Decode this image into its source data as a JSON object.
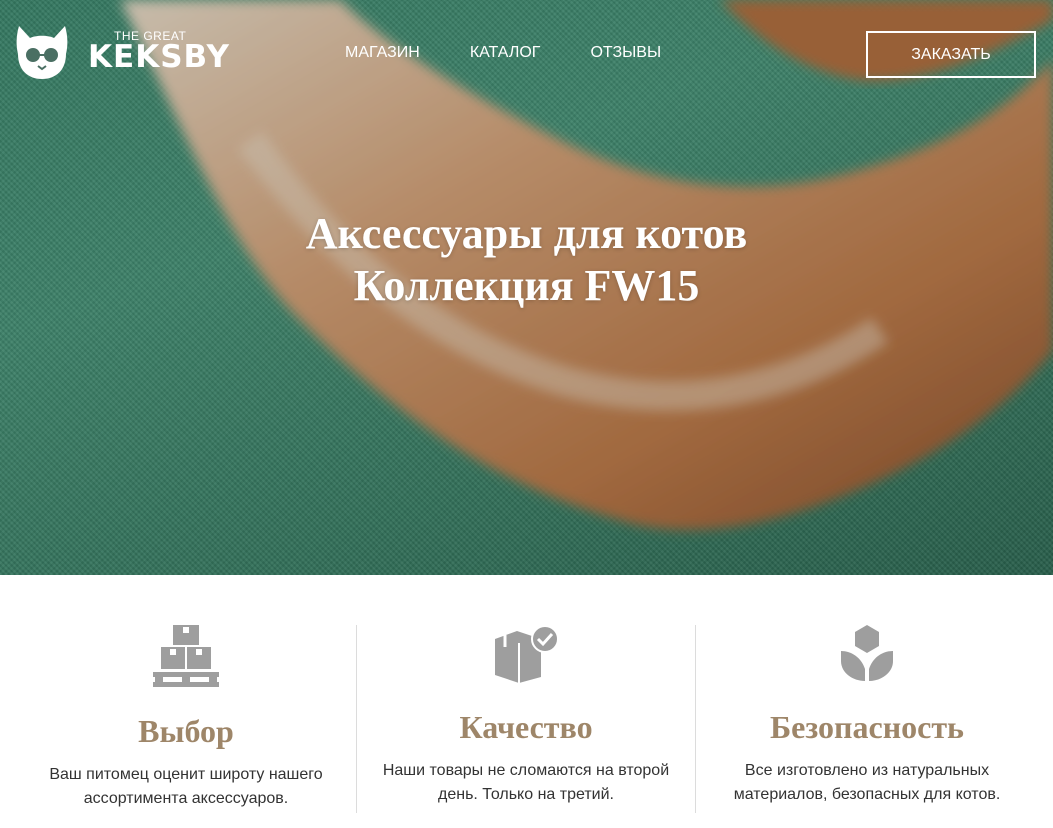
{
  "brand": {
    "small": "THE GREAT",
    "name": "KEKSBY"
  },
  "nav": {
    "items": [
      "МАГАЗИН",
      "КАТАЛОГ",
      "ОТЗЫВЫ"
    ]
  },
  "order_button": "ЗАКАЗАТЬ",
  "hero": {
    "line1": "Аксессуары для котов",
    "line2": "Коллекция FW15"
  },
  "features": [
    {
      "icon": "boxes-icon",
      "title": "Выбор",
      "text": "Ваш питомец оценит широту нашего ассортимента аксессуаров."
    },
    {
      "icon": "box-check-icon",
      "title": "Качество",
      "text": "Наши товары не сломаются на второй день. Только на третий."
    },
    {
      "icon": "leaf-hex-icon",
      "title": "Безопасность",
      "text": "Все изготовлено из натуральных материалов, безопасных для котов."
    }
  ],
  "colors": {
    "accent": "#9e8669",
    "icon": "#9e9e9e",
    "hero_green": "#4a9a7c"
  }
}
